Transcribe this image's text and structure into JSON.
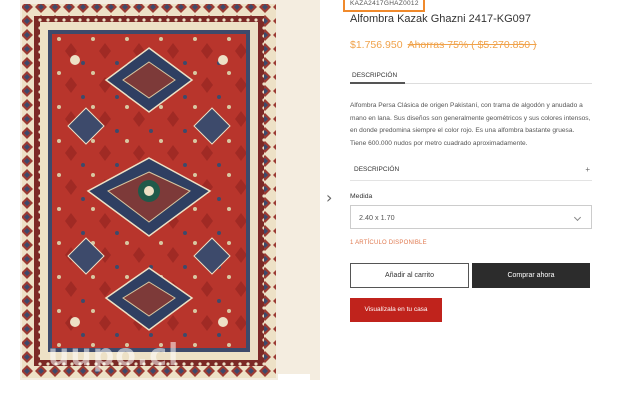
{
  "product": {
    "sku": "KAZA2417GHAZ0012",
    "title": "Alfombra Kazak Ghazni 2417-KG097",
    "price": "$1.756.950",
    "old_price": "Ahorras 75% ( $5.270.850 )",
    "image_alt": "Alfombra Kazak Ghazni roja con medallones"
  },
  "watermark": "uupo.cl",
  "tabs": [
    {
      "label": "DESCRIPCIÓN"
    }
  ],
  "description": "Alfombra Persa Clásica de origen Pakistaní, con trama de algodón y anudado a mano en lana. Sus diseños son generalmente geométricos y sus colores intensos, en donde predomina siempre el color rojo. Es una alfombra bastante gruesa. Tiene 600.000 nudos por metro cuadrado aproximadamente.",
  "accordion": {
    "label": "DESCRIPCIÓN",
    "toggle": "+"
  },
  "size": {
    "label": "Medida",
    "selected": "2.40 x 1.70"
  },
  "stock": "1 ARTÍCULO DISPONIBLE",
  "buttons": {
    "cart": "Añadir al carrito",
    "buy": "Comprar ahora",
    "home": "Visualízala en tu casa"
  },
  "icons": {
    "next_arrow": "chevron-right-icon",
    "select_caret": "chevron-down-icon"
  },
  "colors": {
    "price": "#f0a24a",
    "sku_highlight": "#f08a2c",
    "buy_button": "#2c2c2c",
    "home_button": "#c0231c",
    "rug_field": "#b8352c",
    "rug_border": "#ede1c6"
  }
}
